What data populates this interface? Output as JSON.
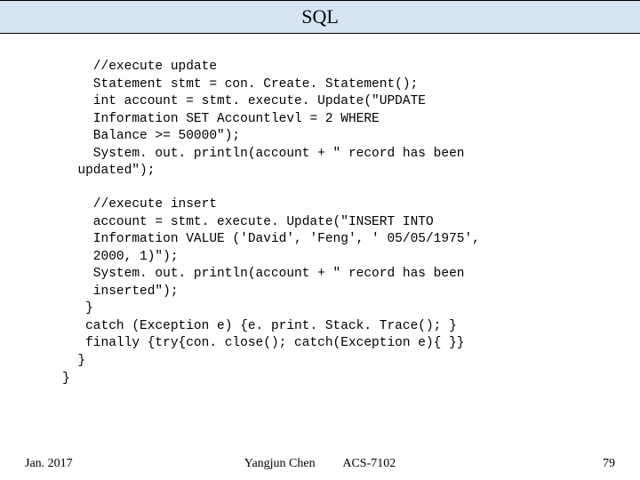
{
  "header": {
    "title": "SQL"
  },
  "code": {
    "block1": "    //execute update\n    Statement stmt = con. Create. Statement();\n    int account = stmt. execute. Update(\"UPDATE\n    Information SET Accountlevl = 2 WHERE\n    Balance >= 50000\");\n    System. out. println(account + \" record has been\n  updated\");",
    "block2": "    //execute insert\n    account = stmt. execute. Update(\"INSERT INTO\n    Information VALUE ('David', 'Feng', ' 05/05/1975',\n    2000, 1)\");\n    System. out. println(account + \" record has been\n    inserted\");\n   }\n   catch (Exception e) {e. print. Stack. Trace(); }\n   finally {try{con. close(); catch(Exception e){ }}\n  }\n}"
  },
  "footer": {
    "date": "Jan. 2017",
    "author": "Yangjun Chen",
    "course": "ACS-7102",
    "page": "79"
  }
}
